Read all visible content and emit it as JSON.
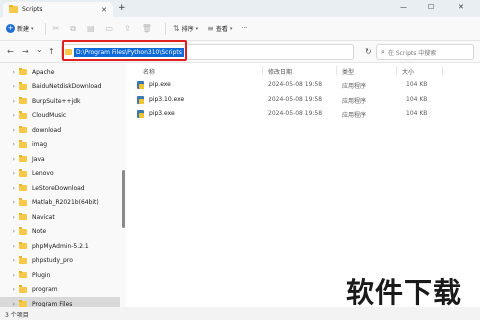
{
  "window": {
    "tab_title": "Scripts",
    "tab_close": "✕",
    "tab_add": "+",
    "minimize": "—",
    "maximize": "☐",
    "close": "✕"
  },
  "toolbar": {
    "new_label": "新建",
    "sort_label": "排序",
    "view_label": "查看",
    "more": "···"
  },
  "nav": {
    "back": "←",
    "forward": "→",
    "dropdown": "⌄",
    "up": "↑",
    "address": "D:\\Program Files\\Python310\\Scripts",
    "refresh": "↻",
    "search_placeholder": "在 Scripts 中搜索"
  },
  "sidebar": {
    "items": [
      {
        "label": "Apache"
      },
      {
        "label": "BaiduNetdiskDownload"
      },
      {
        "label": "BurpSuite++jdk"
      },
      {
        "label": "CloudMusic"
      },
      {
        "label": "download"
      },
      {
        "label": "imag"
      },
      {
        "label": "Java"
      },
      {
        "label": "Lenovo"
      },
      {
        "label": "LeStoreDownload"
      },
      {
        "label": "Matlab_R2021b(64bit)"
      },
      {
        "label": "Navicat"
      },
      {
        "label": "Note"
      },
      {
        "label": "phpMyAdmin-5.2.1"
      },
      {
        "label": "phpstudy_pro"
      },
      {
        "label": "Plugin"
      },
      {
        "label": "program"
      },
      {
        "label": "Program Files"
      }
    ],
    "selected_index": 16
  },
  "table": {
    "headers": {
      "name": "名称",
      "modified": "修改日期",
      "type": "类型",
      "size": "大小"
    },
    "rows": [
      {
        "name": "pip.exe",
        "modified": "2024-05-08 19:58",
        "type": "应用程序",
        "size": "104 KB"
      },
      {
        "name": "pip3.10.exe",
        "modified": "2024-05-08 19:58",
        "type": "应用程序",
        "size": "104 KB"
      },
      {
        "name": "pip3.exe",
        "modified": "2024-05-08 19:58",
        "type": "应用程序",
        "size": "104 KB"
      }
    ]
  },
  "status": {
    "item_count": "3 个项目"
  },
  "watermark": {
    "text": "软件下载"
  },
  "colors": {
    "accent": "#0d6ad8",
    "highlight_box": "#e02020",
    "folder": "#f7c948"
  }
}
